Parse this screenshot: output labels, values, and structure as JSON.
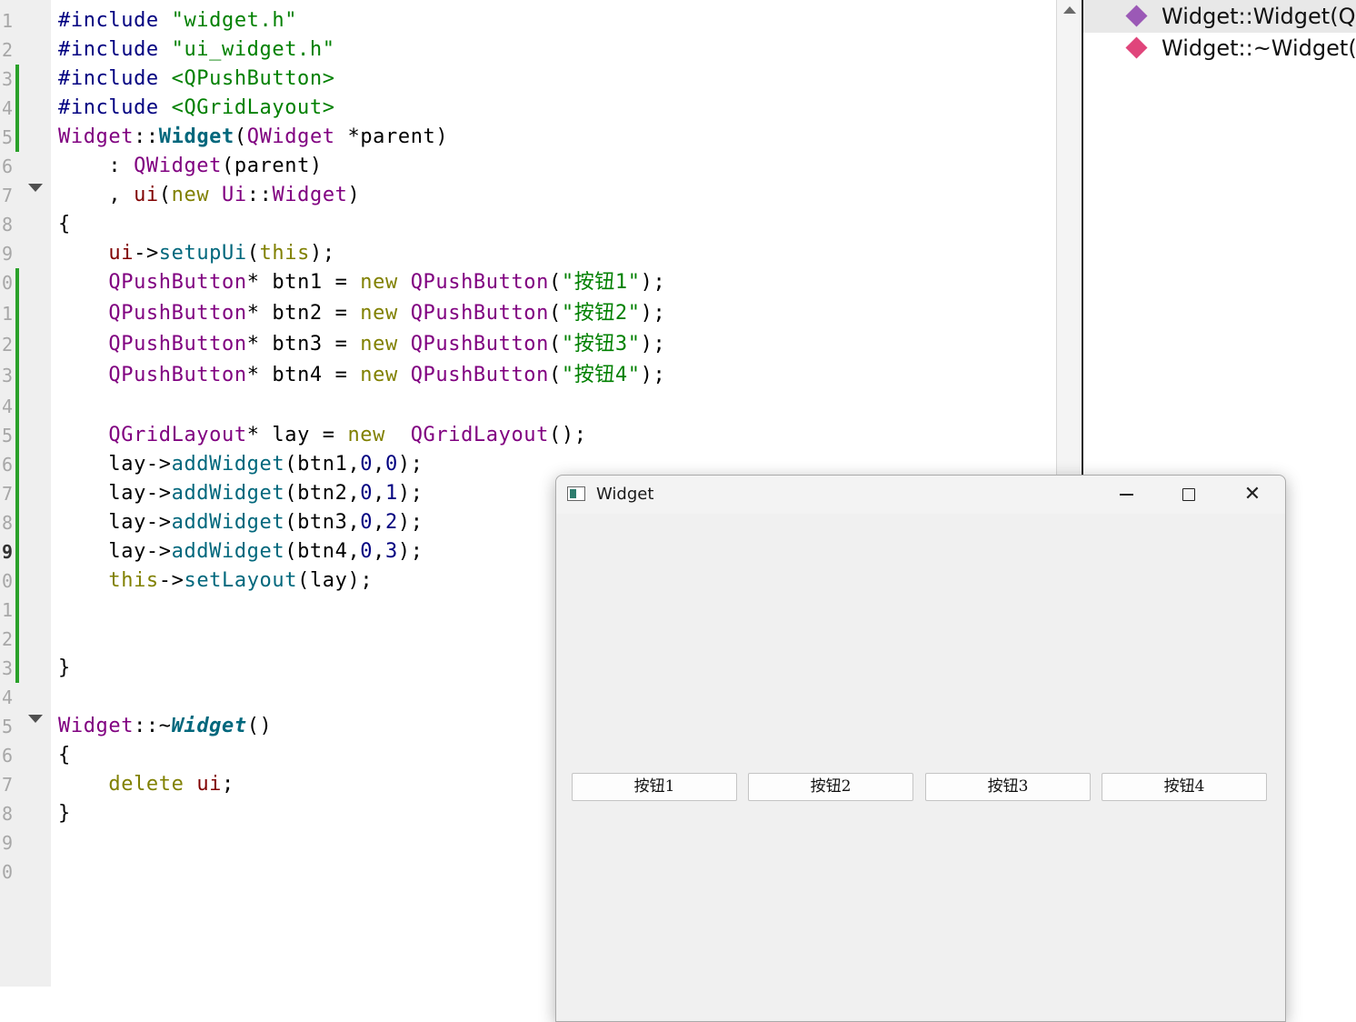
{
  "editor": {
    "line_numbers": [
      "1",
      "2",
      "3",
      "4",
      "5",
      "6",
      "7",
      "8",
      "9",
      "0",
      "1",
      "2",
      "3",
      "4",
      "5",
      "6",
      "7",
      "8",
      "9",
      "0",
      "1",
      "2",
      "3",
      "4",
      "5",
      "6",
      "7",
      "8",
      "9",
      "0"
    ],
    "lines": [
      [
        [
          "#include ",
          "c-pp"
        ],
        [
          "\"widget.h\"",
          "c-str"
        ]
      ],
      [
        [
          "#include ",
          "c-pp"
        ],
        [
          "\"ui_widget.h\"",
          "c-str"
        ]
      ],
      [
        [
          "#include ",
          "c-pp"
        ],
        [
          "<QPushButton>",
          "c-str"
        ]
      ],
      [
        [
          "#include ",
          "c-pp"
        ],
        [
          "<QGridLayout>",
          "c-str"
        ]
      ],
      [
        [
          "Widget",
          "c-type"
        ],
        [
          "::",
          ""
        ],
        [
          "Widget",
          "c-fnb"
        ],
        [
          "(",
          ""
        ],
        [
          "QWidget",
          "c-type"
        ],
        [
          " *parent)",
          ""
        ]
      ],
      [
        [
          "    : ",
          ""
        ],
        [
          "QWidget",
          "c-type"
        ],
        [
          "(parent)",
          ""
        ]
      ],
      [
        [
          "    , ",
          ""
        ],
        [
          "ui",
          "c-mem"
        ],
        [
          "(",
          ""
        ],
        [
          "new",
          "c-kw"
        ],
        [
          " ",
          ""
        ],
        [
          "Ui",
          "c-type"
        ],
        [
          "::",
          ""
        ],
        [
          "Widget",
          "c-type"
        ],
        [
          ")",
          ""
        ]
      ],
      [
        [
          "{",
          ""
        ]
      ],
      [
        [
          "    ",
          ""
        ],
        [
          "ui",
          "c-mem"
        ],
        [
          "->",
          ""
        ],
        [
          "setupUi",
          "c-fn"
        ],
        [
          "(",
          ""
        ],
        [
          "this",
          "c-kw"
        ],
        [
          ");",
          ""
        ]
      ],
      [
        [
          "    ",
          ""
        ],
        [
          "QPushButton",
          "c-type"
        ],
        [
          "* btn1 = ",
          ""
        ],
        [
          "new",
          "c-kw"
        ],
        [
          " ",
          ""
        ],
        [
          "QPushButton",
          "c-type"
        ],
        [
          "(",
          ""
        ],
        [
          "\"按钮1\"",
          "c-str"
        ],
        [
          ");",
          ""
        ]
      ],
      [
        [
          "    ",
          ""
        ],
        [
          "QPushButton",
          "c-type"
        ],
        [
          "* btn2 = ",
          ""
        ],
        [
          "new",
          "c-kw"
        ],
        [
          " ",
          ""
        ],
        [
          "QPushButton",
          "c-type"
        ],
        [
          "(",
          ""
        ],
        [
          "\"按钮2\"",
          "c-str"
        ],
        [
          ");",
          ""
        ]
      ],
      [
        [
          "    ",
          ""
        ],
        [
          "QPushButton",
          "c-type"
        ],
        [
          "* btn3 = ",
          ""
        ],
        [
          "new",
          "c-kw"
        ],
        [
          " ",
          ""
        ],
        [
          "QPushButton",
          "c-type"
        ],
        [
          "(",
          ""
        ],
        [
          "\"按钮3\"",
          "c-str"
        ],
        [
          ");",
          ""
        ]
      ],
      [
        [
          "    ",
          ""
        ],
        [
          "QPushButton",
          "c-type"
        ],
        [
          "* btn4 = ",
          ""
        ],
        [
          "new",
          "c-kw"
        ],
        [
          " ",
          ""
        ],
        [
          "QPushButton",
          "c-type"
        ],
        [
          "(",
          ""
        ],
        [
          "\"按钮4\"",
          "c-str"
        ],
        [
          ");",
          ""
        ]
      ],
      [
        [
          "",
          ""
        ]
      ],
      [
        [
          "    ",
          ""
        ],
        [
          "QGridLayout",
          "c-type"
        ],
        [
          "* lay = ",
          ""
        ],
        [
          "new",
          "c-kw"
        ],
        [
          "  ",
          ""
        ],
        [
          "QGridLayout",
          "c-type"
        ],
        [
          "();",
          ""
        ]
      ],
      [
        [
          "    lay->",
          ""
        ],
        [
          "addWidget",
          "c-fn"
        ],
        [
          "(btn1,",
          ""
        ],
        [
          "0",
          "c-num"
        ],
        [
          ",",
          ""
        ],
        [
          "0",
          "c-num"
        ],
        [
          ");",
          ""
        ]
      ],
      [
        [
          "    lay->",
          ""
        ],
        [
          "addWidget",
          "c-fn"
        ],
        [
          "(btn2,",
          ""
        ],
        [
          "0",
          "c-num"
        ],
        [
          ",",
          ""
        ],
        [
          "1",
          "c-num"
        ],
        [
          ");",
          ""
        ]
      ],
      [
        [
          "    lay->",
          ""
        ],
        [
          "addWidget",
          "c-fn"
        ],
        [
          "(btn3,",
          ""
        ],
        [
          "0",
          "c-num"
        ],
        [
          ",",
          ""
        ],
        [
          "2",
          "c-num"
        ],
        [
          ");",
          ""
        ]
      ],
      [
        [
          "    lay->",
          ""
        ],
        [
          "addWidget",
          "c-fn"
        ],
        [
          "(btn4,",
          ""
        ],
        [
          "0",
          "c-num"
        ],
        [
          ",",
          ""
        ],
        [
          "3",
          "c-num"
        ],
        [
          ");",
          ""
        ]
      ],
      [
        [
          "    ",
          ""
        ],
        [
          "this",
          "c-kw"
        ],
        [
          "->",
          ""
        ],
        [
          "setLayout",
          "c-fn"
        ],
        [
          "(lay);",
          ""
        ]
      ],
      [
        [
          "",
          ""
        ]
      ],
      [
        [
          "",
          ""
        ]
      ],
      [
        [
          "}",
          ""
        ]
      ],
      [
        [
          "",
          ""
        ]
      ],
      [
        [
          "Widget",
          "c-type"
        ],
        [
          "::~",
          ""
        ],
        [
          "Widget",
          "c-fnbi"
        ],
        [
          "()",
          ""
        ]
      ],
      [
        [
          "{",
          ""
        ]
      ],
      [
        [
          "    ",
          ""
        ],
        [
          "delete",
          "c-kw"
        ],
        [
          " ",
          ""
        ],
        [
          "ui",
          "c-mem"
        ],
        [
          ";",
          ""
        ]
      ],
      [
        [
          "}",
          ""
        ]
      ],
      [
        [
          "",
          ""
        ]
      ],
      [
        [
          "",
          ""
        ]
      ]
    ]
  },
  "outline": {
    "items": [
      {
        "label": "Widget::Widget(QWidget *parent)",
        "color": "#9b59b6"
      },
      {
        "label": "Widget::~Widget()",
        "color": "#e0457b"
      }
    ]
  },
  "widget_window": {
    "title": "Widget",
    "close_glyph": "✕",
    "buttons": [
      "按钮1",
      "按钮2",
      "按钮3",
      "按钮4"
    ]
  }
}
